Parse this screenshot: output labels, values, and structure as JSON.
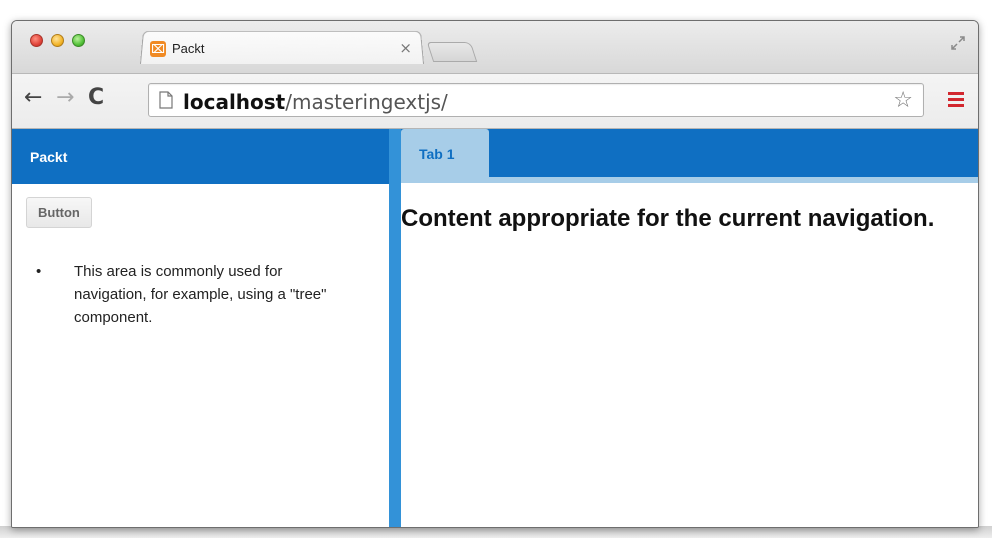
{
  "browser": {
    "tab": {
      "title": "Packt",
      "favicon_glyph": "⌧",
      "close_glyph": "×"
    },
    "url": {
      "host": "localhost",
      "path": "/masteringextjs/"
    },
    "icons": {
      "back": "←",
      "forward": "→",
      "reload": "C",
      "star": "☆"
    },
    "colors": {
      "close": "#e0443a",
      "minimize": "#f3b52a",
      "maximize": "#54c23a",
      "menu": "#d2272e"
    }
  },
  "app": {
    "west": {
      "title": "Packt",
      "button_label": "Button",
      "items": [
        "This area is commonly used for navigation, for example, using a \"tree\" component."
      ]
    },
    "center": {
      "tabs": [
        {
          "label": "Tab 1"
        }
      ],
      "heading": "Content appropriate for the current navigation."
    },
    "colors": {
      "header_blue": "#0f6fc2",
      "splitter_blue": "#3392d8",
      "tab_light_blue": "#a7cde8"
    }
  }
}
